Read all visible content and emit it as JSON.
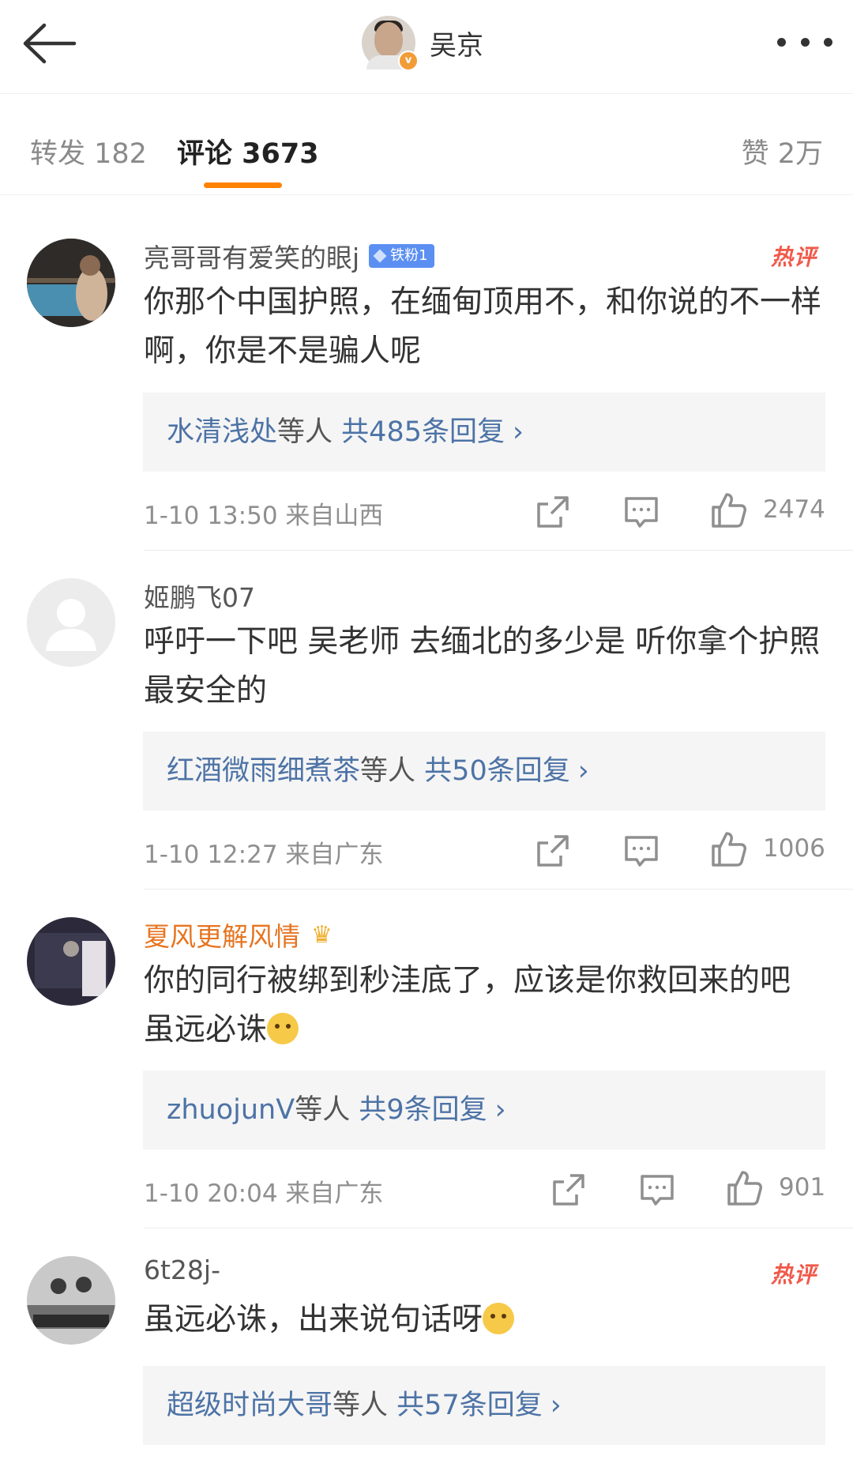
{
  "header": {
    "title": "吴京",
    "badge": "v"
  },
  "tabs": {
    "repost": "转发 182",
    "comment": "评论 3673",
    "like": "赞 2万"
  },
  "comments": [
    {
      "username": "亮哥哥有爱笑的眼j",
      "fan_badge": "铁粉1",
      "hot": "热评",
      "text": "你那个中国护照，在缅甸顶用不，和你说的不一样啊，你是不是骗人呢",
      "reply_users": "水清浅处",
      "reply_suffix": "等人",
      "reply_count": "共485条回复",
      "time": "1-10 13:50",
      "location": "来自山西",
      "likes": "2474"
    },
    {
      "username": "姬鹏飞07",
      "text": "呼吁一下吧  吴老师   去缅北的多少是  听你拿个护照最安全的",
      "reply_users": "红酒微雨细煮茶",
      "reply_suffix": "等人",
      "reply_count": "共50条回复",
      "time": "1-10 12:27",
      "location": "来自广东",
      "likes": "1006"
    },
    {
      "username": "夏风更解风情",
      "text": "你的同行被绑到秒洼底了，应该是你救回来的吧 虽远必诛",
      "reply_users": "zhuojunV",
      "reply_suffix": "等人",
      "reply_count": "共9条回复",
      "time": "1-10 20:04",
      "location": "来自广东",
      "likes": "901"
    },
    {
      "username": "6t28j-",
      "hot": "热评",
      "text": "虽远必诛，出来说句话呀",
      "reply_users": "超级时尚大哥",
      "reply_suffix": "等人",
      "reply_count": "共57条回复"
    }
  ],
  "reply_arrow": "›",
  "colors": {
    "accent": "#ff8200",
    "link": "#4d73a6",
    "hot": "#f05a4a",
    "vip_name": "#e67522",
    "fan_badge": "#5b8ff2"
  },
  "icons": [
    "back-arrow-icon",
    "more-icon",
    "share-icon",
    "comment-icon",
    "like-icon",
    "crown-icon",
    "diamond-icon",
    "emoji-icon"
  ]
}
